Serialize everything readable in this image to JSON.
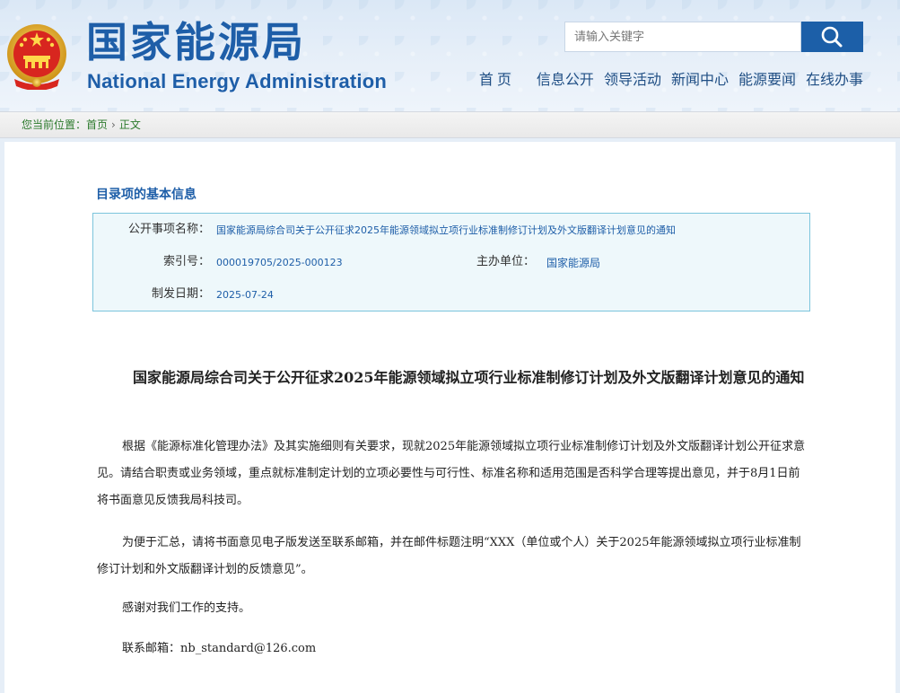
{
  "header": {
    "title_cn": "国家能源局",
    "title_en": "National Energy Administration",
    "emblem_icon": "national-emblem-icon",
    "search": {
      "placeholder": "请输入关键字",
      "button_icon": "search-icon"
    }
  },
  "nav": {
    "items": [
      "首页",
      "信息公开",
      "领导活动",
      "新闻中心",
      "能源要闻",
      "在线办事"
    ]
  },
  "breadcrumb": {
    "prefix": "您当前位置：",
    "home": "首页",
    "separator": "›",
    "current": "正文"
  },
  "info": {
    "heading": "目录项的基本信息",
    "name_label": "公开事项名称：",
    "name_value": "国家能源局综合司关于公开征求2025年能源领域拟立项行业标准制修订计划及外文版翻译计划意见的通知",
    "index_label": "索引号：",
    "index_value": "000019705/2025-000123",
    "org_label": "主办单位：",
    "org_value": "国家能源局",
    "date_label": "制发日期：",
    "date_value": "2025-07-24"
  },
  "article": {
    "title": "国家能源局综合司关于公开征求2025年能源领域拟立项行业标准制修订计划及外文版翻译计划意见的通知",
    "paragraphs": [
      "根据《能源标准化管理办法》及其实施细则有关要求，现就2025年能源领域拟立项行业标准制修订计划及外文版翻译计划公开征求意见。请结合职责或业务领域，重点就标准制定计划的立项必要性与可行性、标准名称和适用范围是否科学合理等提出意见，并于8月1日前将书面意见反馈我局科技司。",
      "为便于汇总，请将书面意见电子版发送至联系邮箱，并在邮件标题注明“XXX（单位或个人）关于2025年能源领域拟立项行业标准制修订计划和外文版翻译计划的反馈意见”。",
      "感谢对我们工作的支持。",
      "联系邮箱：nb_standard@126.com"
    ]
  },
  "colors": {
    "brand_blue": "#1e5ea8",
    "nav_text": "#1f4e84",
    "breadcrumb_green": "#2c7a2c",
    "info_border": "#7cc4dc",
    "info_bg": "#eef8fb"
  }
}
